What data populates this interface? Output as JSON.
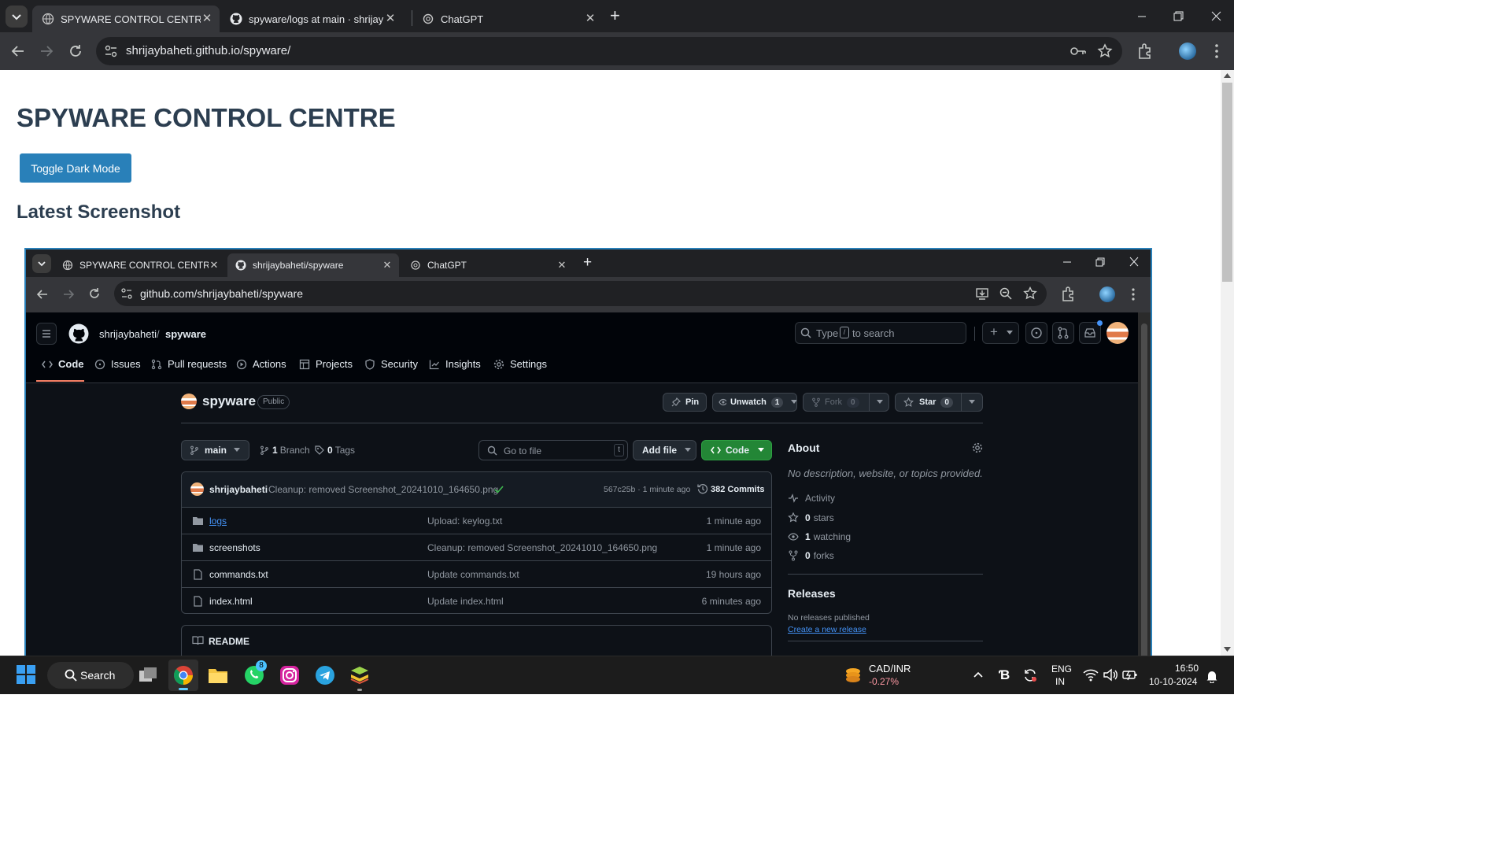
{
  "browser": {
    "tabs": [
      {
        "title": "SPYWARE CONTROL CENTRE",
        "active": true
      },
      {
        "title": "spyware/logs at main · shrijayba",
        "active": false
      },
      {
        "title": "ChatGPT",
        "active": false
      }
    ],
    "url": "shrijaybaheti.github.io/spyware/"
  },
  "page": {
    "title": "SPYWARE CONTROL CENTRE",
    "toggle_label": "Toggle Dark Mode",
    "section_title": "Latest Screenshot"
  },
  "inner_browser": {
    "tabs": [
      {
        "title": "SPYWARE CONTROL CENTRE",
        "active": false
      },
      {
        "title": "shrijaybaheti/spyware",
        "active": true
      },
      {
        "title": "ChatGPT",
        "active": false
      }
    ],
    "url": "github.com/shrijaybaheti/spyware"
  },
  "github": {
    "owner": "shrijaybaheti",
    "separator": "/",
    "repo": "spyware",
    "search_prefix": "Type",
    "search_key": "/",
    "search_suffix": "to search",
    "nav": [
      "Code",
      "Issues",
      "Pull requests",
      "Actions",
      "Projects",
      "Security",
      "Insights",
      "Settings"
    ],
    "visibility": "Public",
    "pin": "Pin",
    "unwatch": "Unwatch",
    "watch_count": "1",
    "fork": "Fork",
    "fork_count": "0",
    "star": "Star",
    "star_count": "0",
    "branch": "main",
    "branches_count": "1",
    "branches_label": "Branch",
    "tags_count": "0",
    "tags_label": "Tags",
    "goto_placeholder": "Go to file",
    "goto_key": "t",
    "add_file": "Add file",
    "code_btn": "Code",
    "commit": {
      "author": "shrijaybaheti",
      "message": "Cleanup: removed Screenshot_20241010_164650.png",
      "hash_time": "567c25b · 1 minute ago",
      "commits": "382 Commits"
    },
    "files": [
      {
        "name": "logs",
        "type": "folder",
        "message": "Upload: keylog.txt",
        "time": "1 minute ago"
      },
      {
        "name": "screenshots",
        "type": "folder",
        "message": "Cleanup: removed Screenshot_20241010_164650.png",
        "time": "1 minute ago"
      },
      {
        "name": "commands.txt",
        "type": "file",
        "message": "Update commands.txt",
        "time": "19 hours ago"
      },
      {
        "name": "index.html",
        "type": "file",
        "message": "Update index.html",
        "time": "6 minutes ago"
      }
    ],
    "readme": "README",
    "about": {
      "title": "About",
      "description": "No description, website, or topics provided.",
      "activity": "Activity",
      "stars_n": "0",
      "stars": "stars",
      "watching_n": "1",
      "watching": "watching",
      "forks_n": "0",
      "forks": "forks"
    },
    "releases": {
      "title": "Releases",
      "none": "No releases published",
      "create": "Create a new release"
    }
  },
  "taskbar": {
    "search": "Search",
    "whatsapp_badge": "8",
    "ticker_name": "CAD/INR",
    "ticker_change": "-0.27%",
    "lang": "ENG",
    "region": "IN",
    "time": "16:50",
    "date": "10-10-2024"
  },
  "colors": {
    "title_text": "#2c3e50",
    "button_bg": "#2980b9",
    "gh_green": "#238636",
    "ticker_down": "#ff99a4"
  }
}
